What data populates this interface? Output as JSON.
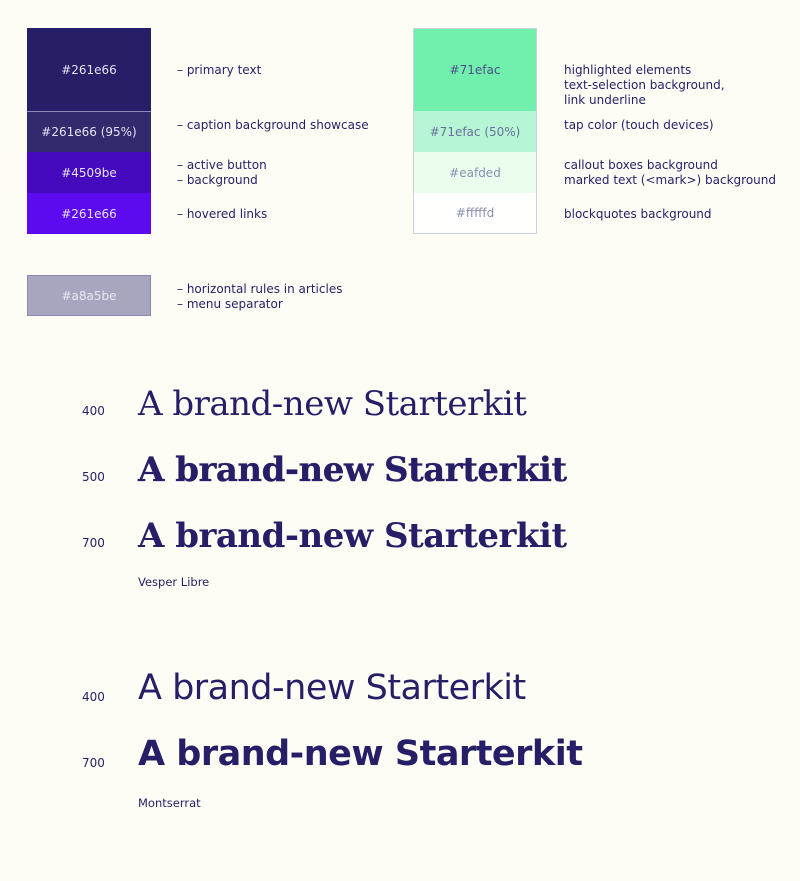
{
  "palette_left": [
    {
      "label": "#261e66",
      "color": "#261e66",
      "text_color": "#e5e2f5",
      "desc": [
        "– primary text"
      ]
    },
    {
      "label": "#261e66 (95%)",
      "color": "#312a6c",
      "text_color": "#e5e2f5",
      "desc": [
        "– caption background showcase"
      ]
    },
    {
      "label": "#4509be",
      "color": "#4509be",
      "text_color": "#e5e2f5",
      "desc": [
        "– active button",
        "– background"
      ]
    },
    {
      "label": "#261e66",
      "color": "#5c0bf0",
      "text_color": "#e5e2f5",
      "desc": [
        "– hovered links"
      ]
    }
  ],
  "palette_right": [
    {
      "label": "#71efac",
      "color": "#71efac",
      "text_color": "#4a4f8a",
      "desc": [
        "highlighted elements",
        "text-selection background,",
        "link underline"
      ]
    },
    {
      "label": "#71efac (50%)",
      "color": "#b7f6d4",
      "text_color": "#6a6f9e",
      "desc": [
        "tap color (touch devices)"
      ]
    },
    {
      "label": "#eafded",
      "color": "#eafded",
      "text_color": "#8a8db0",
      "desc": [
        "callout boxes background",
        "marked text (<mark>) background"
      ]
    },
    {
      "label": "#fffffd",
      "color": "#fffffd",
      "text_color": "#8a8db0",
      "desc": [
        "blockquotes background"
      ]
    }
  ],
  "separator_swatch": {
    "label": "#a8a5be",
    "color": "#a8a5be",
    "text_color": "#e8e6f2",
    "desc": [
      "– horizontal rules in articles",
      "– menu separator"
    ]
  },
  "typography": {
    "sample_text": "A brand-new Starterkit",
    "serif": {
      "name": "Vesper Libre",
      "weights": [
        "400",
        "500",
        "700"
      ]
    },
    "sans": {
      "name": "Montserrat",
      "weights": [
        "400",
        "700"
      ]
    }
  }
}
